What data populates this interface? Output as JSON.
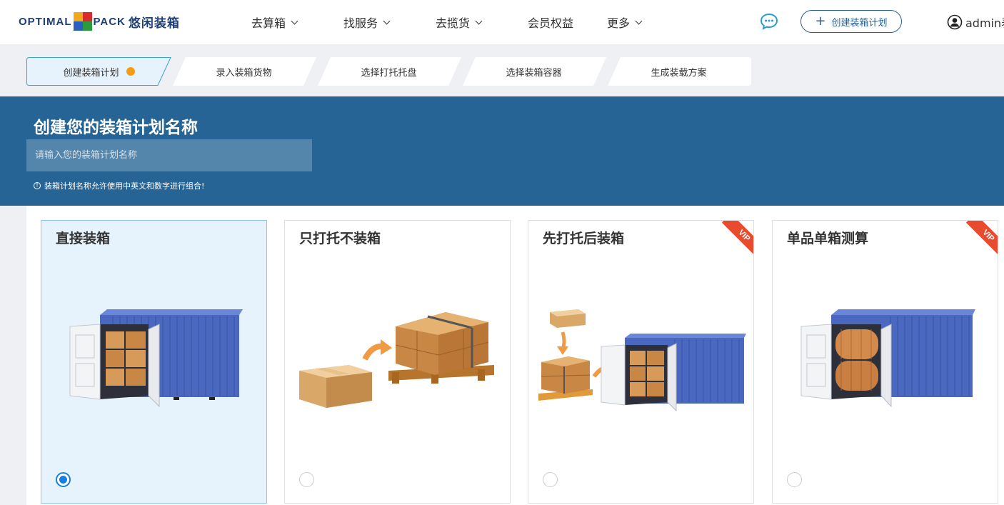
{
  "header": {
    "logo_text_left": "OPTIMAL",
    "logo_text_right": "PACK",
    "logo_text_cn": "悠闲装箱",
    "menu": [
      {
        "label": "去算箱",
        "has_dropdown": true
      },
      {
        "label": "找服务",
        "has_dropdown": true
      },
      {
        "label": "去揽货",
        "has_dropdown": true
      },
      {
        "label": "会员权益",
        "has_dropdown": false
      },
      {
        "label": "更多",
        "has_dropdown": true
      }
    ],
    "chat_icon": "chat-bubble-icon",
    "create_button": "创建装箱计划",
    "user": "admin表"
  },
  "steps": [
    {
      "label": "创建装箱计划",
      "active": true
    },
    {
      "label": "录入装箱货物",
      "active": false
    },
    {
      "label": "选择打托托盘",
      "active": false
    },
    {
      "label": "选择装箱容器",
      "active": false
    },
    {
      "label": "生成装载方案",
      "active": false
    }
  ],
  "banner": {
    "title": "创建您的装箱计划名称",
    "input_value": "",
    "input_placeholder": "请输入您的装箱计划名称",
    "hint": "装箱计划名称允许使用中英文和数字进行组合!"
  },
  "cards": [
    {
      "title": "直接装箱",
      "selected": true,
      "vip": false
    },
    {
      "title": "只打托不装箱",
      "selected": false,
      "vip": false
    },
    {
      "title": "先打托后装箱",
      "selected": false,
      "vip": true
    },
    {
      "title": "单品单箱测算",
      "selected": false,
      "vip": true
    }
  ],
  "vip_label": "VIP",
  "colors": {
    "banner": "#256494",
    "accent": "#1a7ee0",
    "step_active_border": "#3aa3c9",
    "step_dot": "#f59c14",
    "vip": "#e94b2f",
    "selected_card": "#e6f3fd"
  }
}
